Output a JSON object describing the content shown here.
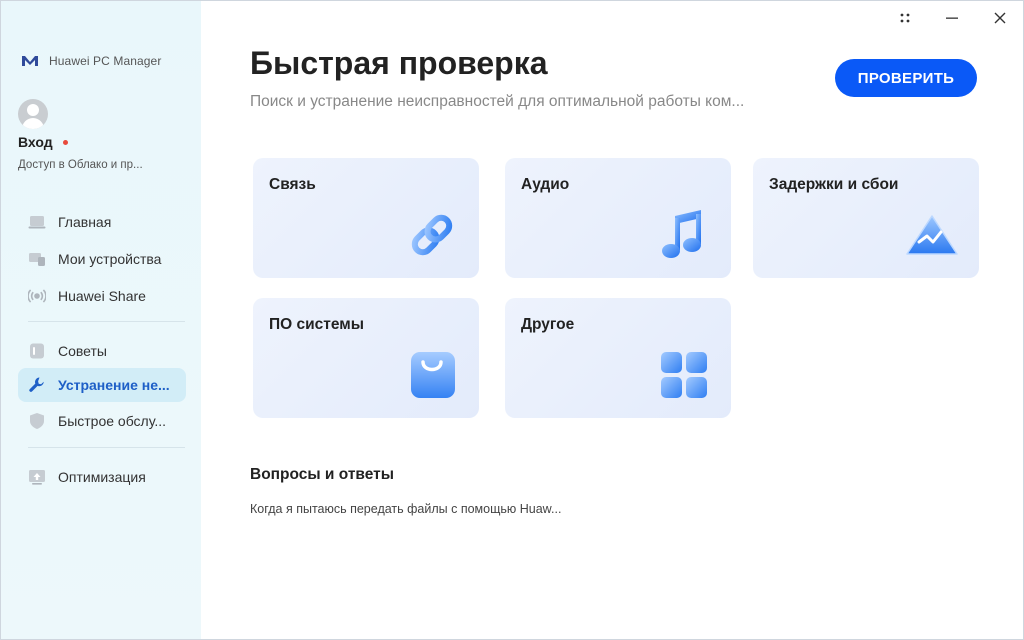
{
  "app": {
    "name": "Huawei PC Manager"
  },
  "user": {
    "login_label": "Вход",
    "subtitle": "Доступ в Облако и пр..."
  },
  "sidebar": {
    "items": [
      {
        "label": "Главная",
        "icon": "laptop-icon"
      },
      {
        "label": "Мои устройства",
        "icon": "devices-icon"
      },
      {
        "label": "Huawei Share",
        "icon": "share-icon"
      },
      {
        "label": "Советы",
        "icon": "tips-icon"
      },
      {
        "label": "Устранение не...",
        "icon": "wrench-icon",
        "active": true
      },
      {
        "label": "Быстрое обслу...",
        "icon": "shield-icon"
      },
      {
        "label": "Оптимизация",
        "icon": "optimize-icon"
      }
    ]
  },
  "main": {
    "title": "Быстрая проверка",
    "subtitle": "Поиск и устранение неисправностей для оптимальной работы ком...",
    "check_button": "ПРОВЕРИТЬ",
    "cards": [
      {
        "label": "Связь",
        "icon": "link-icon"
      },
      {
        "label": "Аудио",
        "icon": "music-note-icon"
      },
      {
        "label": "Задержки и сбои",
        "icon": "mountain-icon"
      },
      {
        "label": "ПО системы",
        "icon": "shopping-bag-icon"
      },
      {
        "label": "Другое",
        "icon": "apps-grid-icon"
      }
    ],
    "faq": {
      "title": "Вопросы и ответы",
      "items": [
        "Когда я пытаюсь передать файлы с помощью Huaw..."
      ]
    }
  },
  "colors": {
    "accent": "#0a59f7",
    "active_nav_bg": "#d2edf7",
    "active_nav_text": "#1e5fc7",
    "sidebar_bg": "#eaf7fb",
    "card_bg": "#e7eefc",
    "notification_dot": "#e84a3c"
  }
}
